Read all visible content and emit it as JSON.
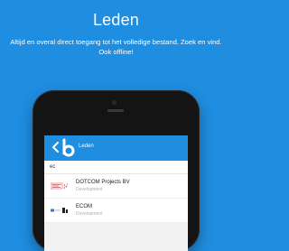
{
  "header": {
    "title": "Leden",
    "subtitle": "Altijd en overal direct toegang tot het volledige bestand. Zoek en vind. Ook offline!"
  },
  "app": {
    "title": "Leden",
    "search_value": "ec",
    "members": [
      {
        "name": "DOTCOM Projects BV",
        "subtitle": "Development"
      },
      {
        "name": "ECOM",
        "subtitle": "Development"
      }
    ]
  },
  "colors": {
    "background": "#1f8de0",
    "appbar": "#1f8de0",
    "phone": "#141414"
  }
}
